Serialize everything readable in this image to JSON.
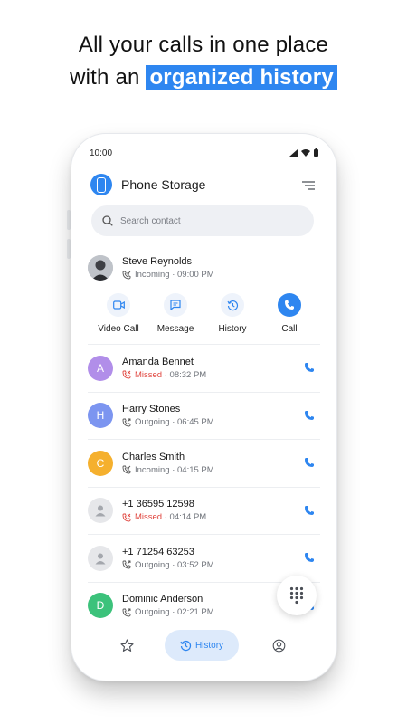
{
  "headline": {
    "line1": "All your calls in one place",
    "line2_prefix": "with an",
    "line2_highlight": "organized history"
  },
  "status_bar": {
    "time": "10:00"
  },
  "app": {
    "title": "Phone Storage",
    "menu_icon": "sort-lines-icon"
  },
  "search": {
    "placeholder": "Search contact"
  },
  "expanded_contact": {
    "name": "Steve Reynolds",
    "call_type": "Incoming",
    "time": "09:00 PM",
    "actions": [
      {
        "label": "Video Call",
        "icon": "video-camera-icon"
      },
      {
        "label": "Message",
        "icon": "message-icon"
      },
      {
        "label": "History",
        "icon": "history-icon"
      },
      {
        "label": "Call",
        "icon": "phone-icon"
      }
    ]
  },
  "calls": [
    {
      "name": "Amanda Bennet",
      "initial": "A",
      "avatar_color": "#b18ee9",
      "call_type": "Missed",
      "time": "08:32 PM"
    },
    {
      "name": "Harry Stones",
      "initial": "H",
      "avatar_color": "#7c95f0",
      "call_type": "Outgoing",
      "time": "06:45 PM"
    },
    {
      "name": "Charles Smith",
      "initial": "C",
      "avatar_color": "#f5b02e",
      "call_type": "Incoming",
      "time": "04:15 PM"
    },
    {
      "name": "+1 36595 12598",
      "initial": "",
      "avatar_color": "#e6e7ea",
      "call_type": "Missed",
      "time": "04:14 PM"
    },
    {
      "name": "+1 71254 63253",
      "initial": "",
      "avatar_color": "#e6e7ea",
      "call_type": "Outgoing",
      "time": "03:52 PM"
    },
    {
      "name": "Dominic Anderson",
      "initial": "D",
      "avatar_color": "#3cc27b",
      "call_type": "Outgoing",
      "time": "02:21 PM"
    }
  ],
  "bottom_nav": {
    "favorites_icon": "star-icon",
    "history_label": "History",
    "contacts_icon": "person-circle-icon"
  },
  "colors": {
    "accent": "#2e86f0",
    "missed": "#e0453e"
  }
}
